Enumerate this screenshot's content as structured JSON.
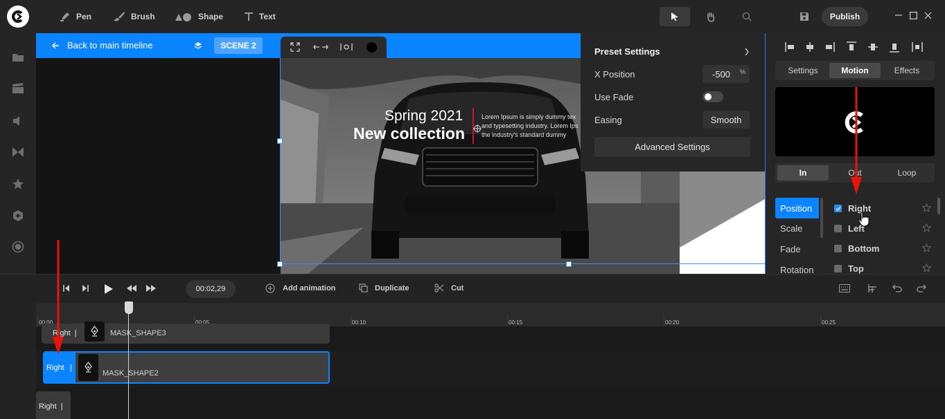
{
  "toolbar": {
    "tools": [
      {
        "label": "Pen",
        "icon": "pen-icon"
      },
      {
        "label": "Brush",
        "icon": "brush-icon"
      },
      {
        "label": "Shape",
        "icon": "shape-icon"
      },
      {
        "label": "Text",
        "icon": "text-icon"
      }
    ],
    "publish_label": "Publish"
  },
  "scene_bar": {
    "back_label": "Back to main timeline",
    "scene_label": "SCENE 2"
  },
  "canvas": {
    "headline_light": "Spring 2021",
    "headline_bold": "New collection",
    "lorem_lines": [
      "Lorem Ipsum is simply dummy tex",
      "and typesetting industry. Lorem Ips",
      "the industry's standard dummy"
    ]
  },
  "preset": {
    "title": "Preset Settings",
    "x_position_label": "X Position",
    "x_position_value": "-500",
    "x_position_unit": "%",
    "use_fade_label": "Use Fade",
    "use_fade_on": false,
    "easing_label": "Easing",
    "easing_value": "Smooth",
    "advanced_label": "Advanced Settings"
  },
  "right_panel": {
    "tabs": [
      "Settings",
      "Motion",
      "Effects"
    ],
    "active_tab": "Motion",
    "subtabs": [
      "In",
      "Out",
      "Loop"
    ],
    "active_subtab": "In",
    "properties": [
      "Position",
      "Scale",
      "Fade",
      "Rotation"
    ],
    "active_property": "Position",
    "directions": [
      {
        "label": "Right",
        "checked": true
      },
      {
        "label": "Left",
        "checked": false
      },
      {
        "label": "Bottom",
        "checked": false
      },
      {
        "label": "Top",
        "checked": false
      }
    ]
  },
  "timeline": {
    "timecode": "00:02,29",
    "add_animation_label": "Add animation",
    "duplicate_label": "Duplicate",
    "cut_label": "Cut",
    "ruler_labels": [
      "00:00",
      "00:05",
      "00:10",
      "00:15",
      "00:20",
      "00:25"
    ],
    "tracks": [
      {
        "tag": "Right",
        "name": "MASK_SHAPE3"
      },
      {
        "tag": "Right",
        "name": "MASK_SHAPE2"
      },
      {
        "tag": "Right",
        "name": ""
      }
    ]
  },
  "colors": {
    "accent": "#0a84ff",
    "annotation_arrow": "#e8140c"
  }
}
